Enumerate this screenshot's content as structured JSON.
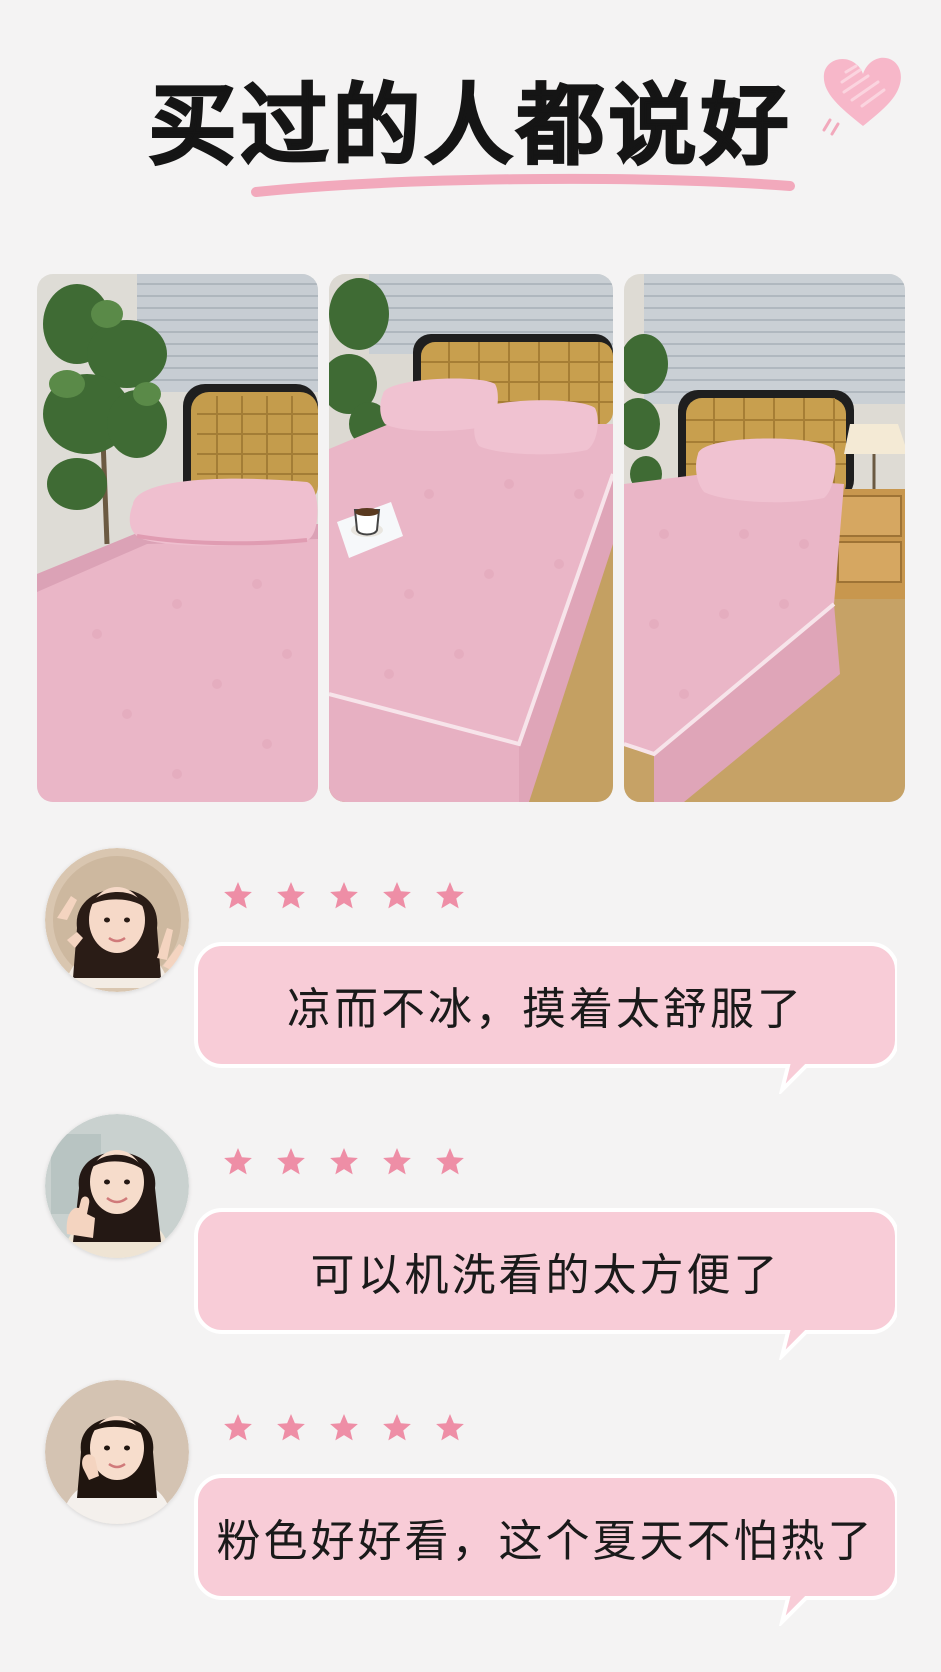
{
  "title": "买过的人都说好",
  "accent_color": "#f5c8d3",
  "star_color": "#ee8ea6",
  "photos": [
    {
      "name": "bed-photo-1"
    },
    {
      "name": "bed-photo-2"
    },
    {
      "name": "bed-photo-3"
    }
  ],
  "reviews": [
    {
      "rating": 5,
      "text": "凉而不冰，摸着太舒服了"
    },
    {
      "rating": 5,
      "text": "可以机洗看的太方便了"
    },
    {
      "rating": 5,
      "text": "粉色好好看，这个夏天不怕热了"
    }
  ]
}
